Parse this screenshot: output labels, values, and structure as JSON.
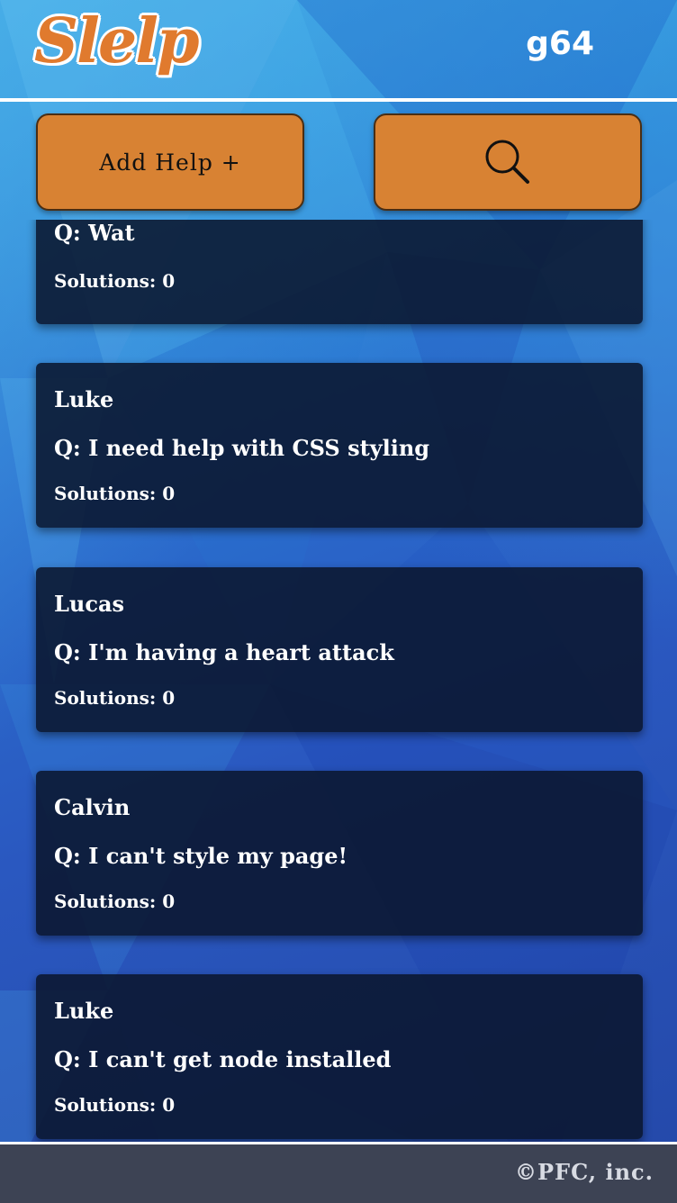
{
  "header": {
    "logo": "Slelp",
    "username": "g64"
  },
  "toolbar": {
    "add_help_label": "Add Help +",
    "search_icon": "search-icon"
  },
  "posts": [
    {
      "author": "",
      "question": "Q: Wat",
      "solutions": "Solutions: 0"
    },
    {
      "author": "Luke",
      "question": "Q: I need help with CSS styling",
      "solutions": "Solutions: 0"
    },
    {
      "author": "Lucas",
      "question": "Q: I'm having a heart attack",
      "solutions": "Solutions: 0"
    },
    {
      "author": "Calvin",
      "question": "Q: I can't style my page!",
      "solutions": "Solutions: 0"
    },
    {
      "author": "Luke",
      "question": "Q: I can't get node installed",
      "solutions": "Solutions: 0"
    }
  ],
  "footer": {
    "copyright": "©PFC, inc."
  },
  "colors": {
    "accent": "#d88233",
    "card_bg": "#0a162e",
    "footer_bg": "#3d4354"
  }
}
